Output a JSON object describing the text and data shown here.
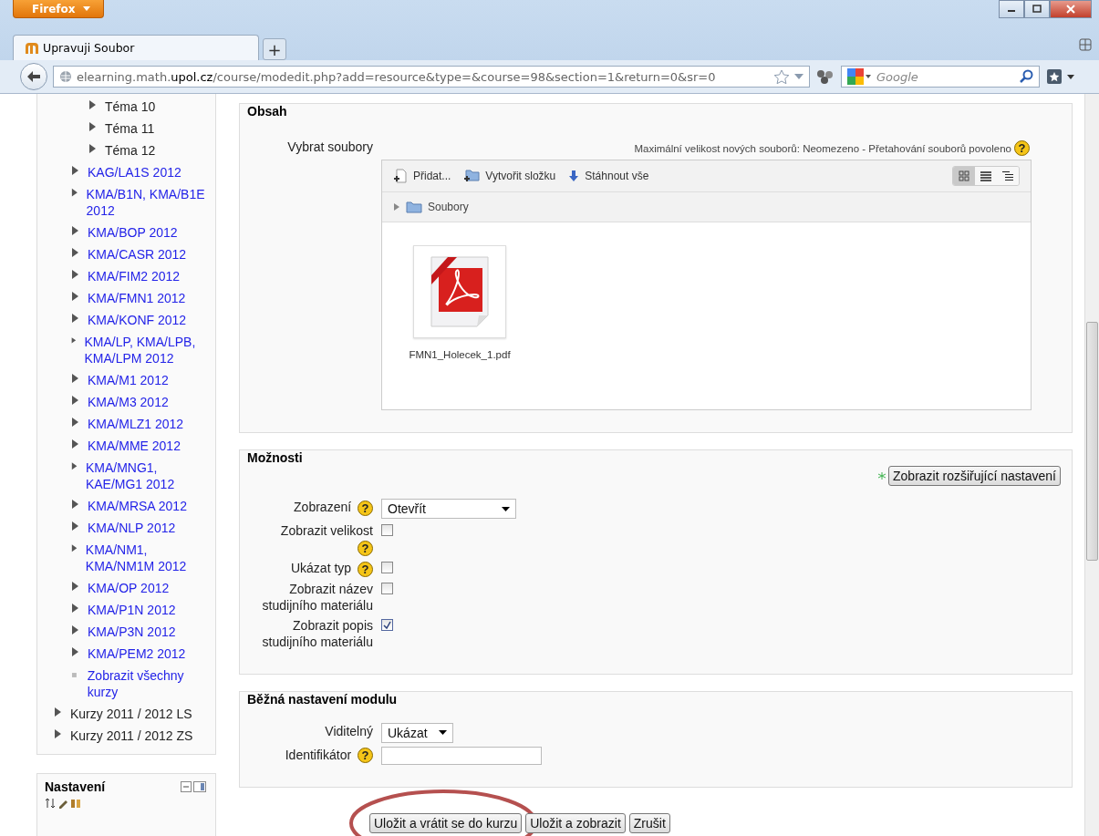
{
  "browser": {
    "menu_button": "Firefox",
    "tab": {
      "title": "Upravuji Soubor",
      "selected": true
    },
    "new_tab": "+",
    "url": "elearning.math.**upol.cz**/course/modedit.php?add=resource&type=&course=98&section=1&return=0&sr=0",
    "search": {
      "placeholder": "Google"
    }
  },
  "sidebar": {
    "tree": [
      {
        "children": [
          {
            "children": [
              {
                "label": "Téma 10",
                "kind": "section"
              },
              {
                "label": "Téma 11",
                "kind": "section"
              },
              {
                "label": "Téma 12",
                "kind": "section"
              }
            ]
          },
          {
            "label": "KAG/LA1S 2012",
            "kind": "course"
          },
          {
            "label": "KMA/B1N, KMA/B1E 2012",
            "kind": "course"
          },
          {
            "label": "KMA/BOP 2012",
            "kind": "course"
          },
          {
            "label": "KMA/CASR 2012",
            "kind": "course"
          },
          {
            "label": "KMA/FIM2 2012",
            "kind": "course"
          },
          {
            "label": "KMA/FMN1 2012",
            "kind": "course"
          },
          {
            "label": "KMA/KONF 2012",
            "kind": "course"
          },
          {
            "label": "KMA/LP, KMA/LPB, KMA/LPM 2012",
            "kind": "course"
          },
          {
            "label": "KMA/M1 2012",
            "kind": "course"
          },
          {
            "label": "KMA/M3 2012",
            "kind": "course"
          },
          {
            "label": "KMA/MLZ1 2012",
            "kind": "course"
          },
          {
            "label": "KMA/MME 2012",
            "kind": "course"
          },
          {
            "label": "KMA/MNG1, KAE/MG1 2012",
            "kind": "course"
          },
          {
            "label": "KMA/MRSA 2012",
            "kind": "course"
          },
          {
            "label": "KMA/NLP 2012",
            "kind": "course"
          },
          {
            "label": "KMA/NM1, KMA/NM1M 2012",
            "kind": "course"
          },
          {
            "label": "KMA/OP 2012",
            "kind": "course"
          },
          {
            "label": "KMA/P1N 2012",
            "kind": "course"
          },
          {
            "label": "KMA/P3N 2012",
            "kind": "course"
          },
          {
            "label": "KMA/PEM2 2012",
            "kind": "course"
          },
          {
            "label": "Zobrazit všechny kurzy",
            "kind": "link"
          }
        ]
      },
      {
        "label": "Kurzy 2011 / 2012 LS",
        "kind": "category"
      },
      {
        "label": "Kurzy 2011 / 2012 ZS",
        "kind": "category"
      }
    ],
    "settings_block": {
      "title": "Nastavení"
    }
  },
  "form": {
    "sections": [
      {
        "kind": "files",
        "legend": "Obsah",
        "label": "Vybrat soubory",
        "info": "Maximální velikost nových souborů: Neomezeno - Přetahování souborů povoleno",
        "help": "?",
        "actions": [
          {
            "label": "Přidat...",
            "kind": "add"
          },
          {
            "label": "Vytvořit složku",
            "kind": "folder"
          },
          {
            "label": "Stáhnout vše",
            "kind": "download"
          }
        ],
        "views": [
          {
            "kind": "icons",
            "selected": true
          },
          {
            "kind": "list",
            "selected": false
          },
          {
            "kind": "tree",
            "selected": false
          }
        ],
        "path": "Soubory",
        "files": [
          {
            "name": "FMN1_Holecek_1.pdf"
          }
        ]
      },
      {
        "kind": "fields",
        "legend": "Možnosti",
        "advanced_button": "Zobrazit rozšiřující nastavení",
        "fields": [
          {
            "kind": "select",
            "label": "Zobrazení",
            "help": "?",
            "value": "Otevřít"
          },
          {
            "kind": "checkbox",
            "label": "Zobrazit velikost",
            "help": "?",
            "checked": false
          },
          {
            "kind": "checkbox",
            "label": "Ukázat typ",
            "help": "?",
            "checked": false
          },
          {
            "kind": "checkbox",
            "label": "Zobrazit název studijního materiálu",
            "checked": false
          },
          {
            "kind": "checkbox",
            "label": "Zobrazit popis studijního materiálu",
            "checked": true
          }
        ]
      },
      {
        "kind": "fields",
        "legend": "Běžná nastavení modulu",
        "fields": [
          {
            "kind": "select",
            "label": "Viditelný",
            "value": "Ukázat"
          },
          {
            "kind": "text",
            "label": "Identifikátor",
            "help": "?"
          }
        ]
      }
    ],
    "buttons": [
      {
        "label": "Uložit a vrátit se do kurzu",
        "circled": true
      },
      {
        "label": "Uložit a zobrazit",
        "circled": false
      },
      {
        "label": "Zrušit",
        "circled": false
      }
    ]
  }
}
